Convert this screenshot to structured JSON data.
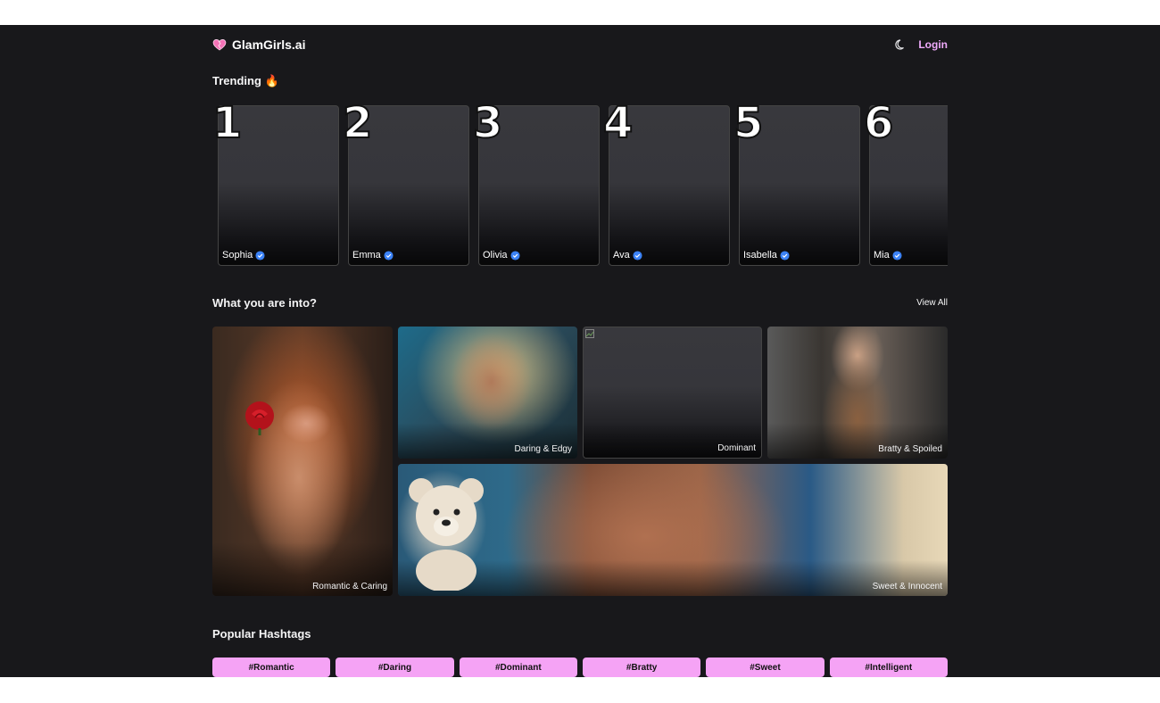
{
  "header": {
    "brand": "GlamGirls.ai",
    "login_label": "Login"
  },
  "trending": {
    "title": "Trending 🔥",
    "cards": [
      {
        "rank": "1",
        "name": "Sophia"
      },
      {
        "rank": "2",
        "name": "Emma"
      },
      {
        "rank": "3",
        "name": "Olivia"
      },
      {
        "rank": "4",
        "name": "Ava"
      },
      {
        "rank": "5",
        "name": "Isabella"
      },
      {
        "rank": "6",
        "name": "Mia"
      }
    ]
  },
  "categories": {
    "title": "What you are into?",
    "view_all_label": "View All",
    "items": [
      {
        "label": "Romantic & Caring"
      },
      {
        "label": "Daring & Edgy"
      },
      {
        "label": "Dominant"
      },
      {
        "label": "Bratty & Spoiled"
      },
      {
        "label": "Sweet & Innocent"
      }
    ]
  },
  "hashtags": {
    "title": "Popular Hashtags",
    "items": [
      "#Romantic",
      "#Daring",
      "#Dominant",
      "#Bratty",
      "#Sweet",
      "#Intelligent"
    ]
  },
  "colors": {
    "background": "#18181b",
    "accent_pink": "#f0abfc",
    "tag_pink": "#f5a3f5",
    "verified_blue": "#3b82f6"
  },
  "icons": {
    "logo": "heart-icon",
    "theme": "moon-icon",
    "verified": "verified-badge-icon"
  }
}
